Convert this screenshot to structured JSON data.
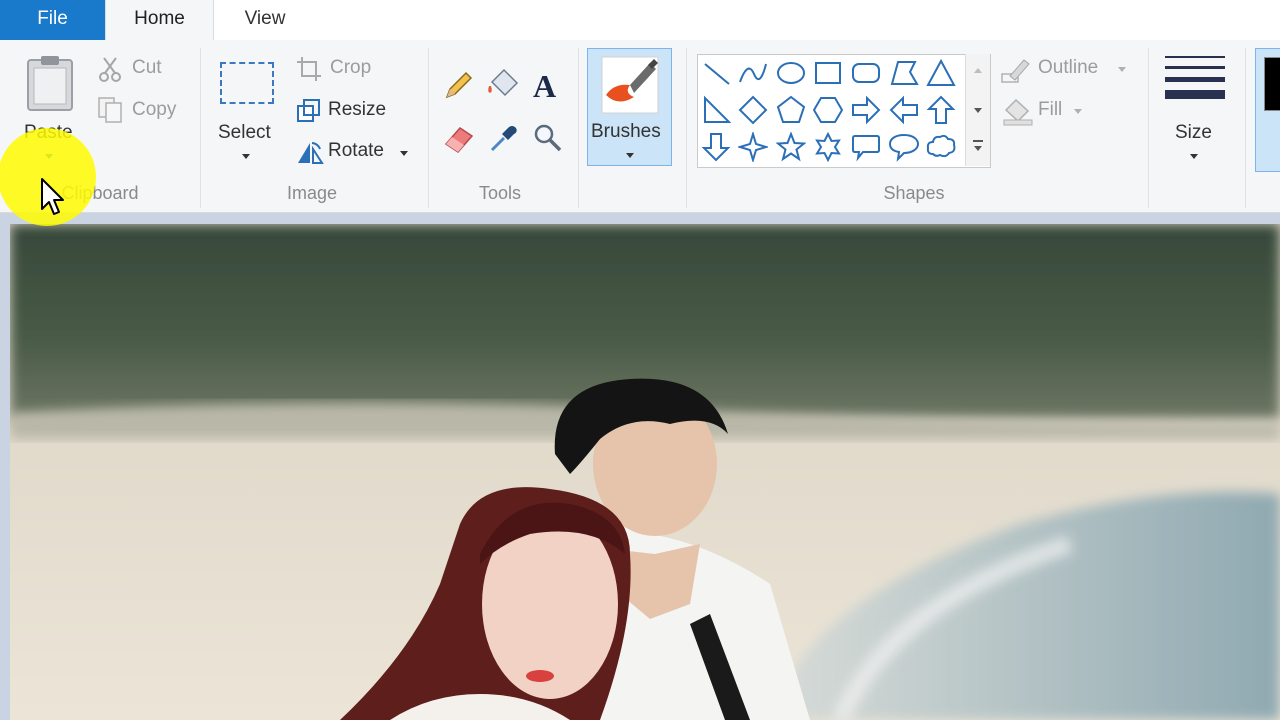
{
  "tabs": {
    "file": "File",
    "home": "Home",
    "view": "View"
  },
  "clipboard": {
    "paste": "Paste",
    "cut": "Cut",
    "copy": "Copy",
    "group": "Clipboard"
  },
  "image": {
    "select": "Select",
    "crop": "Crop",
    "resize": "Resize",
    "rotate": "Rotate",
    "group": "Image"
  },
  "tools": {
    "group": "Tools",
    "text_glyph": "A"
  },
  "brushes": {
    "label": "Brushes"
  },
  "shapes": {
    "outline": "Outline",
    "fill": "Fill",
    "group": "Shapes"
  },
  "size": {
    "label": "Size"
  },
  "colors": {
    "accent": "#1979ca",
    "highlight": "#cce4f7",
    "ribbon": "#f5f6f7"
  }
}
